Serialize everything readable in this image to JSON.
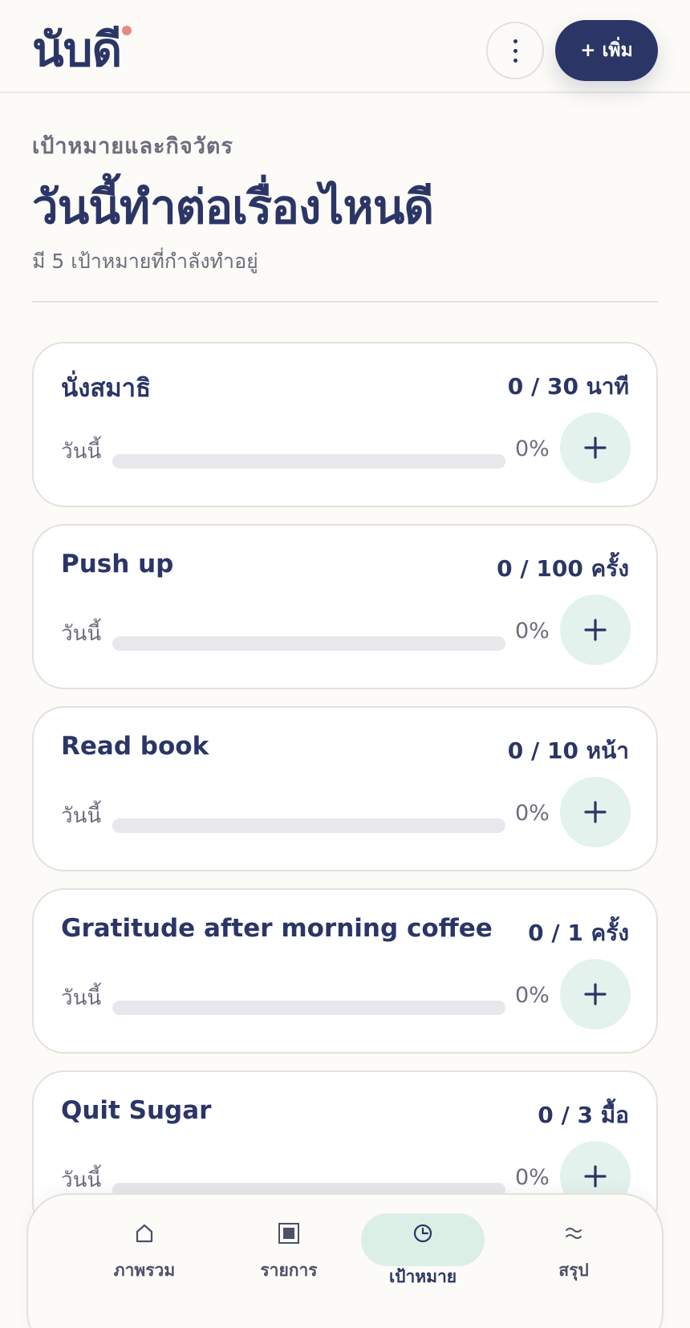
{
  "header": {
    "logo_text": "นับดี",
    "add_button_label": "+ เพิ่ม",
    "more_icon": "more-vertical-icon"
  },
  "intro": {
    "kicker": "เป้าหมายและกิจวัตร",
    "title": "วันนี้ทำต่อเรื่องไหนดี",
    "subtitle": "มี 5 เป้าหมายที่กำลังทำอยู่"
  },
  "goals": [
    {
      "name": "นั่งสมาธิ",
      "count": "0 / 30 นาที",
      "today_label": "วันนี้",
      "percent_text": "0%",
      "progress": 0
    },
    {
      "name": "Push up",
      "count": "0 / 100 ครั้ง",
      "today_label": "วันนี้",
      "percent_text": "0%",
      "progress": 0
    },
    {
      "name": "Read book",
      "count": "0 / 10 หน้า",
      "today_label": "วันนี้",
      "percent_text": "0%",
      "progress": 0
    },
    {
      "name": "Gratitude after morning coffee",
      "count": "0 / 1 ครั้ง",
      "today_label": "วันนี้",
      "percent_text": "0%",
      "progress": 0
    },
    {
      "name": "Quit Sugar",
      "count": "0 / 3 มื้อ",
      "today_label": "วันนี้",
      "percent_text": "0%",
      "progress": 0
    }
  ],
  "nav": {
    "items": [
      {
        "label": "ภาพรวม",
        "icon": "home-icon"
      },
      {
        "label": "รายการ",
        "icon": "list-square-icon"
      },
      {
        "label": "เป้าหมาย",
        "icon": "goal-clock-icon",
        "active": true
      },
      {
        "label": "สรุป",
        "icon": "summary-wave-icon"
      }
    ]
  },
  "colors": {
    "primary": "#2b3566",
    "accent_dot": "#e88a80",
    "plus_bg": "#e3f2ec",
    "active_nav_bg": "#dcefe7",
    "track": "#e8e8ec"
  }
}
